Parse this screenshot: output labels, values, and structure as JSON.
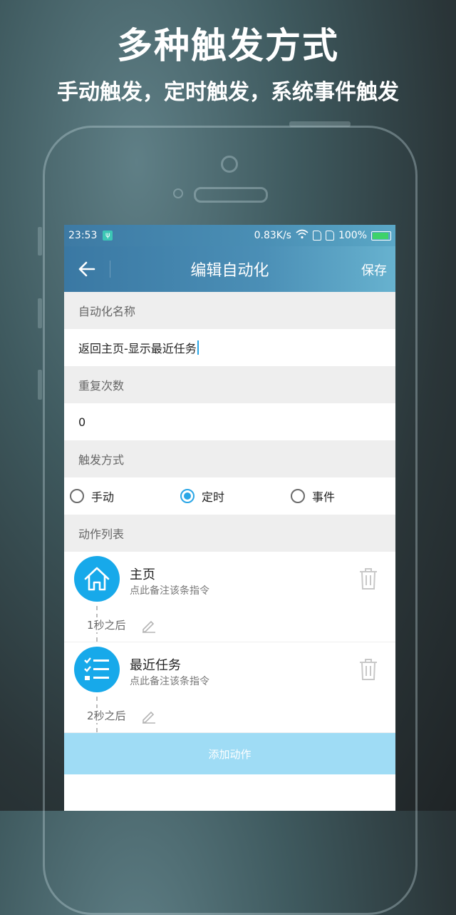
{
  "promo": {
    "title": "多种触发方式",
    "subtitle": "手动触发，定时触发，系统事件触发"
  },
  "statusbar": {
    "time": "23:53",
    "usb_icon": "usb-icon",
    "speed": "0.83K/s",
    "battery": "100%"
  },
  "appbar": {
    "back_icon": "arrow-left-icon",
    "title": "编辑自动化",
    "save_label": "保存"
  },
  "form": {
    "name_header": "自动化名称",
    "name_value": "返回主页-显示最近任务",
    "repeat_header": "重复次数",
    "repeat_value": "0",
    "trigger_header": "触发方式",
    "trigger_options": [
      {
        "label": "手动",
        "checked": false
      },
      {
        "label": "定时",
        "checked": true
      },
      {
        "label": "事件",
        "checked": false
      }
    ],
    "actions_header": "动作列表"
  },
  "actions": [
    {
      "icon": "home-icon",
      "name": "主页",
      "note": "点此备注该条指令",
      "delay": "1秒之后"
    },
    {
      "icon": "list-icon",
      "name": "最近任务",
      "note": "点此备注该条指令",
      "delay": "2秒之后"
    }
  ],
  "add_action_label": "添加动作",
  "colors": {
    "accent": "#17a9ea",
    "appbar": "#4b8fb6",
    "add_button": "#9fdcf5"
  }
}
